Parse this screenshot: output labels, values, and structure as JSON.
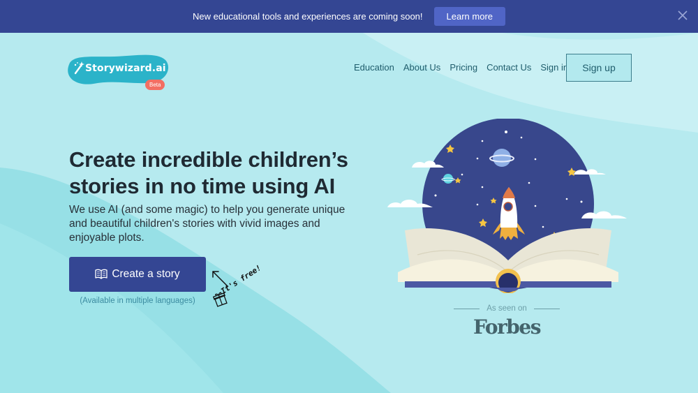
{
  "announcement": {
    "text": "New educational tools and experiences are coming soon!",
    "button_label": "Learn more",
    "close_icon": "close-icon"
  },
  "header": {
    "logo_text": "Storywizard.ai",
    "logo_badge": "Beta",
    "logo_icon": "magic-wand-icon",
    "nav": [
      {
        "label": "Education"
      },
      {
        "label": "About Us"
      },
      {
        "label": "Pricing"
      },
      {
        "label": "Contact Us"
      },
      {
        "label": "Sign in"
      }
    ],
    "signup_label": "Sign up"
  },
  "hero": {
    "title": "Create incredible children’s stories in no time using AI",
    "subtitle": "We use AI (and some magic) to help you generate unique and beautiful children's stories with vivid images and enjoyable plots.",
    "cta_label": "Create a story",
    "cta_icon": "book-icon",
    "cta_note": "(Available in multiple languages)",
    "free_note": "It's free!",
    "free_icons": [
      "arrow-icon",
      "gift-icon"
    ]
  },
  "press": {
    "label": "As seen on",
    "logo_text": "Forbes"
  },
  "colors": {
    "primary": "#344693",
    "button_accent": "#5065c6",
    "background": "#b6eaef",
    "beta_badge": "#f36f63",
    "logo_blob": "#2bb3c9",
    "nav_text": "#1f5d6c"
  }
}
